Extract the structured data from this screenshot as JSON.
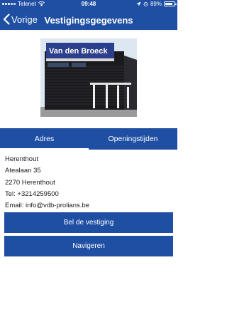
{
  "status_bar": {
    "carrier": "Telenet",
    "time": "09:48",
    "battery": "89%",
    "battery_level": 0.89
  },
  "navbar": {
    "back_label": "Vorige",
    "title": "Vestigingsgegevens"
  },
  "photo": {
    "sign_text": "Van den Broeck"
  },
  "tabs": [
    {
      "label": "Adres",
      "active": true
    },
    {
      "label": "Openingstijden",
      "active": false
    }
  ],
  "address": {
    "name": "Herenthout",
    "street": "Atealaan 35",
    "city": "2270 Herenthout",
    "tel": "Tel: +3214259500",
    "email": "Email: info@vdb-prolians.be"
  },
  "buttons": {
    "call": "Bel de vestiging",
    "navigate": "Navigeren"
  },
  "colors": {
    "primary": "#1f4fa3",
    "text": "#1a1a1a",
    "background": "#ffffff"
  }
}
